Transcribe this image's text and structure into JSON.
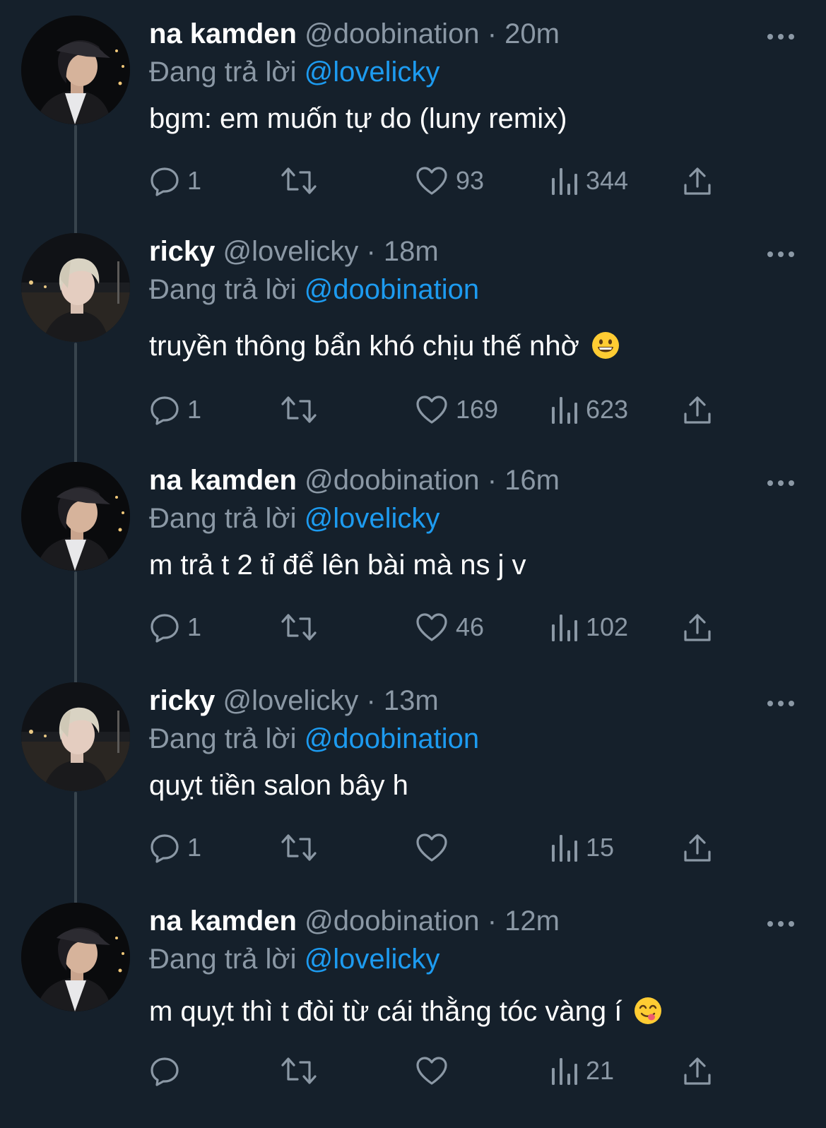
{
  "reply_prefix": "Đang trả lời",
  "tweets": [
    {
      "name": "na kamden",
      "handle": "@doobination",
      "separator": "·",
      "time": "20m",
      "reply_to": "@lovelicky",
      "text": "bgm: em muốn tự do (luny remix)",
      "emoji": "",
      "avatar": "dark-hair-cap-avatar",
      "replies": "1",
      "likes": "93",
      "views": "344"
    },
    {
      "name": "ricky",
      "handle": "@lovelicky",
      "separator": "·",
      "time": "18m",
      "reply_to": "@doobination",
      "text": "truyền thông bẩn khó chịu thế nhờ",
      "emoji": "grinning-face",
      "avatar": "blond-hair-avatar",
      "replies": "1",
      "likes": "169",
      "views": "623"
    },
    {
      "name": "na kamden",
      "handle": "@doobination",
      "separator": "·",
      "time": "16m",
      "reply_to": "@lovelicky",
      "text": "m trả t 2 tỉ để lên bài mà ns j v",
      "emoji": "",
      "avatar": "dark-hair-cap-avatar",
      "replies": "1",
      "likes": "46",
      "views": "102"
    },
    {
      "name": "ricky",
      "handle": "@lovelicky",
      "separator": "·",
      "time": "13m",
      "reply_to": "@doobination",
      "text": "quỵt tiền salon bây h",
      "emoji": "",
      "avatar": "blond-hair-avatar",
      "replies": "1",
      "likes": "",
      "views": "15"
    },
    {
      "name": "na kamden",
      "handle": "@doobination",
      "separator": "·",
      "time": "12m",
      "reply_to": "@lovelicky",
      "text": "m quỵt thì t đòi từ cái thằng tóc vàng í",
      "emoji": "face-savoring-food",
      "avatar": "dark-hair-cap-avatar",
      "replies": "",
      "likes": "",
      "views": "21"
    }
  ],
  "colors": {
    "background": "#15202b",
    "secondary_text": "#8b98a5",
    "link": "#1d9bf0",
    "thread_line": "#38444d"
  }
}
